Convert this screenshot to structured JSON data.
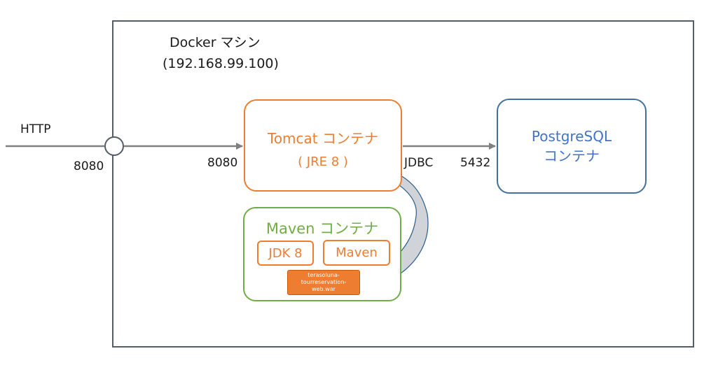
{
  "docker_host": {
    "title": "Docker マシン",
    "ip": "(192.168.99.100)"
  },
  "external": {
    "protocol": "HTTP",
    "port_outer": "8080",
    "port_inner": "8080"
  },
  "tomcat": {
    "title": "Tomcat コンテナ",
    "runtime": "( JRE 8 )"
  },
  "link": {
    "protocol": "JDBC",
    "port": "5432"
  },
  "postgres": {
    "line1": "PostgreSQL",
    "line2": "コンテナ"
  },
  "maven": {
    "title": "Maven コンテナ",
    "jdk": "JDK 8",
    "tool": "Maven",
    "artifact": "terasoluna-tourreservation-web.war"
  },
  "colors": {
    "tomcat": "#ed7d31",
    "postgres": "#4472c4",
    "maven": "#70ad47",
    "arrow": "#808080",
    "deploy_arrow_fill": "#d0d4d9"
  }
}
